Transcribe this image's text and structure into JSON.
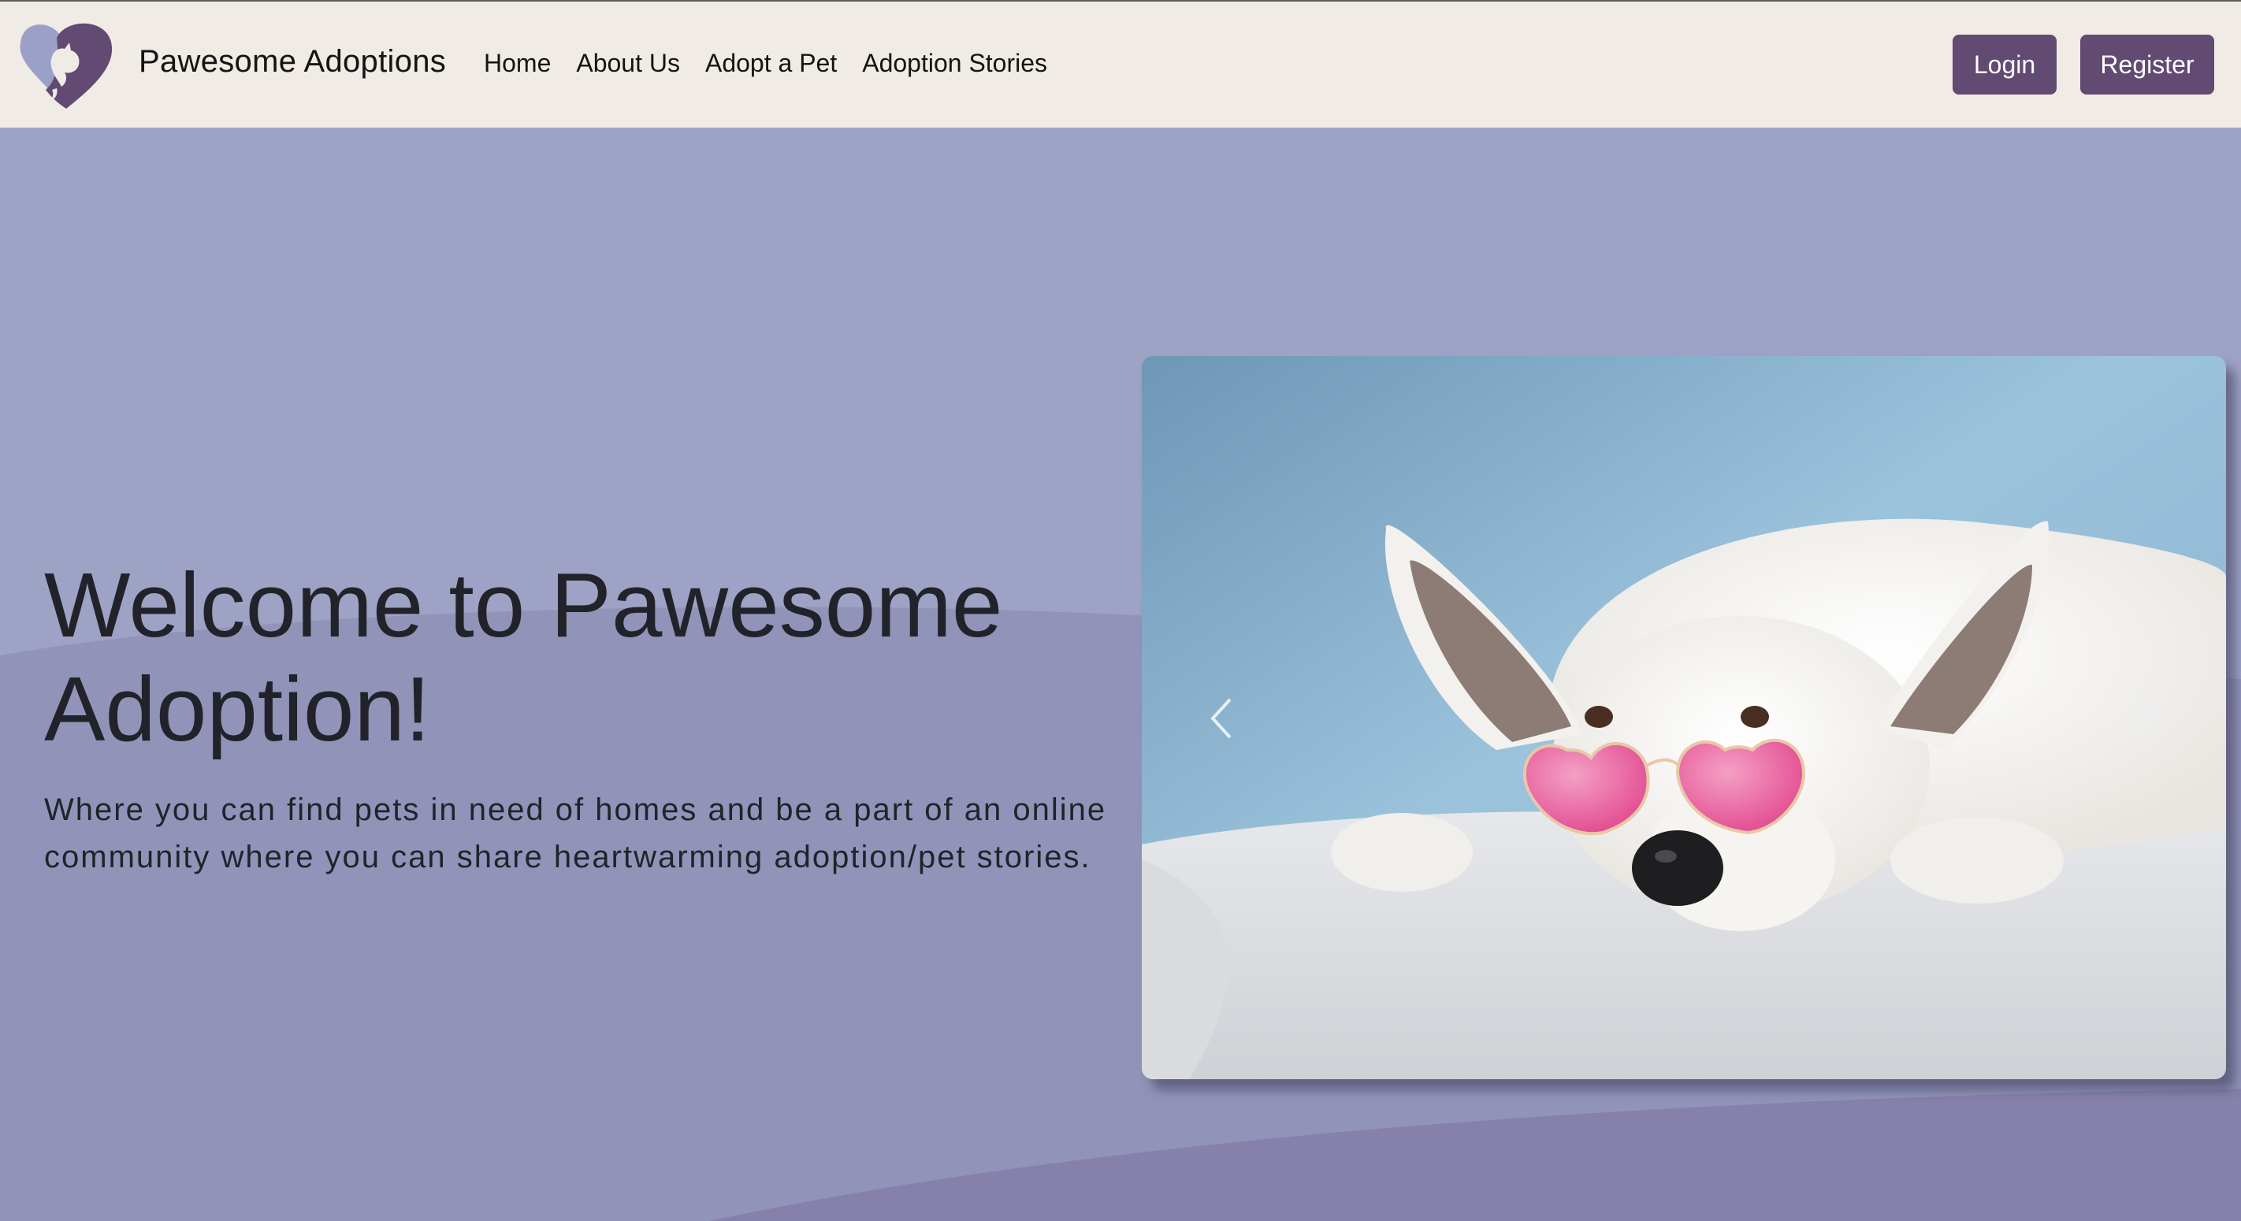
{
  "navbar": {
    "brand_name": "Pawesome Adoptions",
    "links": [
      "Home",
      "About Us",
      "Adopt a Pet",
      "Adoption Stories"
    ],
    "login_label": "Login",
    "register_label": "Register",
    "logo_icon": "heart-paw-logo-icon"
  },
  "hero": {
    "title": "Welcome to Pawesome Adoption!",
    "subtitle": "Where you can find pets in need of homes and be a part of an online community where you can share heartwarming adoption/pet stories."
  },
  "carousel": {
    "image": "white dog wearing pink heart-shaped sunglasses lying on a white blanket",
    "prev_icon": "chevron-left-icon",
    "next_icon": "chevron-right-icon"
  },
  "colors": {
    "navbar_bg": "#f0ebe5",
    "button_bg": "#624a73",
    "hero_bg": "#9ea2c4",
    "text_dark": "#22232a"
  }
}
